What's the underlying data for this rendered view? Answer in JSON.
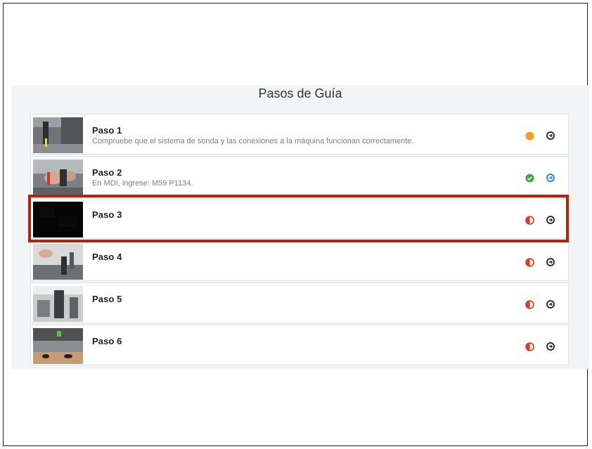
{
  "title": "Pasos de Guía",
  "colors": {
    "highlight": "#b2240f",
    "status_in_progress": "#f39c33",
    "status_done": "#3fa540",
    "status_incomplete": "#e03a1f",
    "arrow_default": "#333333",
    "arrow_active": "#2f86d6"
  },
  "steps": [
    {
      "title": "Paso 1",
      "description": "Compruebe que el sistema de sonda y las conexiones a la máquina funcionan correctamente.",
      "status_icon": "orange-dot-icon",
      "arrow_icon": "arrow-right-circle-icon"
    },
    {
      "title": "Paso 2",
      "description": "En MDI, ingrese: M59 P1134.",
      "status_icon": "check-circle-icon",
      "arrow_icon": "arrow-right-circle-icon"
    },
    {
      "title": "Paso 3",
      "description": "",
      "status_icon": "half-circle-icon",
      "arrow_icon": "arrow-right-circle-icon"
    },
    {
      "title": "Paso 4",
      "description": "",
      "status_icon": "half-circle-icon",
      "arrow_icon": "arrow-right-circle-icon"
    },
    {
      "title": "Paso 5",
      "description": "",
      "status_icon": "half-circle-icon",
      "arrow_icon": "arrow-right-circle-icon"
    },
    {
      "title": "Paso 6",
      "description": "",
      "status_icon": "half-circle-icon",
      "arrow_icon": "arrow-right-circle-icon"
    }
  ]
}
